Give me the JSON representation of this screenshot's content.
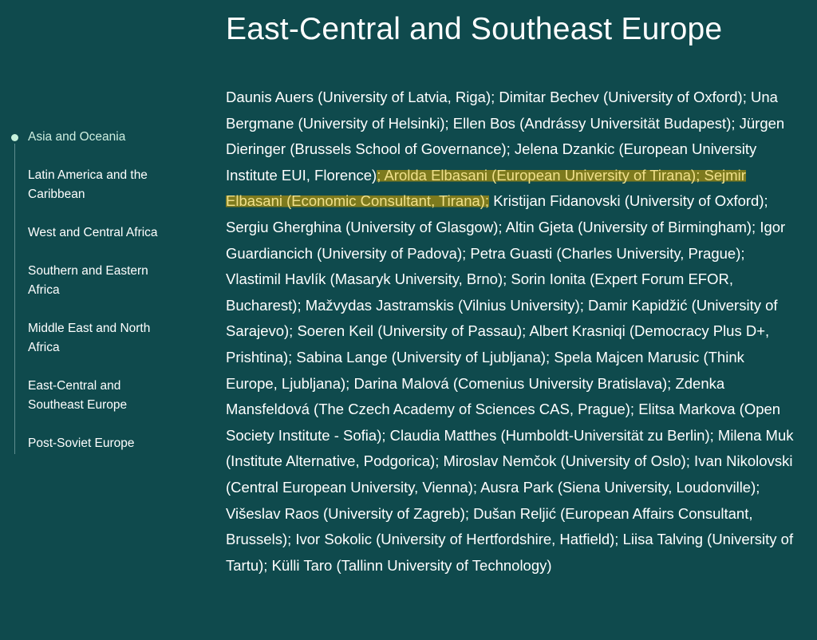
{
  "sidebar": {
    "items": [
      {
        "label": "Asia and Oceania",
        "active": true
      },
      {
        "label": "Latin America and the Caribbean",
        "active": false
      },
      {
        "label": "West and Central Africa",
        "active": false
      },
      {
        "label": "Southern and Eastern Africa",
        "active": false
      },
      {
        "label": "Middle East and North Africa",
        "active": false
      },
      {
        "label": "East-Central and Southeast Europe",
        "active": false
      },
      {
        "label": "Post-Soviet Europe",
        "active": false
      }
    ]
  },
  "main": {
    "title": "East-Central and Southeast Europe",
    "content": {
      "part1": "Daunis Auers (University of Latvia, Riga); Dimitar Bechev (University of Oxford); Una Bergmane (University of Helsinki); Ellen Bos (Andrássy Universität Budapest); Jürgen Dieringer (Brussels School of Governance); Jelena Dzankic (European University Institute EUI, Florence)",
      "highlighted": "; Arolda Elbasani (European University of Tirana); Sejmir Elbasani (Economic Consultant, Tirana);",
      "part2": " Kristijan Fidanovski (University of Oxford); Sergiu Gherghina (University of Glasgow); Altin Gjeta (University of Birmingham); Igor Guardiancich (University of Padova); Petra Guasti (Charles University, Prague); Vlastimil Havlík (Masaryk University, Brno); Sorin Ionita (Expert Forum EFOR, Bucharest); Mažvydas Jastramskis (Vilnius University); Damir Kapidžić (University of Sarajevo); Soeren Keil (University of Passau); Albert Krasniqi (Democracy Plus D+, Prishtina); Sabina Lange (University of Ljubljana); Spela Majcen Marusic (Think Europe, Ljubljana); Darina Malová (Comenius University Bratislava); Zdenka Mansfeldová (The Czech Academy of Sciences CAS, Prague); Elitsa Markova (Open Society Institute - Sofia); Claudia Matthes (Humboldt-Universität zu Berlin); Milena Muk (Institute Alternative, Podgorica); Miroslav Nemčok (University of Oslo); Ivan Nikolovski (Central European University, Vienna); Ausra Park (Siena University, Loudonville); Višeslav Raos (University of Zagreb); Dušan Reljić (European Affairs Consultant, Brussels); Ivor Sokolic (University of Hertfordshire, Hatfield); Liisa Talving (University of Tartu); Külli Taro (Tallinn University of Technology)"
    }
  },
  "colors": {
    "background": "#0f4a4d",
    "highlight": "#7d7a1e",
    "highlight_text": "#f0e08a",
    "active_dot": "#c6f2dc"
  }
}
